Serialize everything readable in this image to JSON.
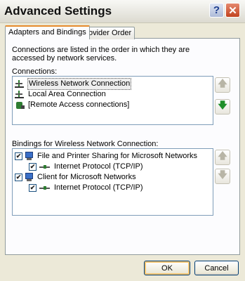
{
  "window": {
    "title": "Advanced Settings",
    "help_label": "?",
    "close_label": "✕"
  },
  "tabs": [
    {
      "label": "Adapters and Bindings",
      "active": true
    },
    {
      "label": "Provider Order",
      "active": false
    }
  ],
  "description": "Connections are listed in the order in which they are accessed by network services.",
  "connections": {
    "label": "Connections:",
    "items": [
      {
        "label": "Wireless Network Connection",
        "icon": "network-adapter-icon",
        "selected": true
      },
      {
        "label": "Local Area Connection",
        "icon": "network-adapter-icon",
        "selected": false
      },
      {
        "label": "[Remote Access connections]",
        "icon": "remote-access-icon",
        "selected": false
      }
    ],
    "move_up": "🡅",
    "move_down": "🡇"
  },
  "bindings": {
    "label": "Bindings for Wireless Network Connection:",
    "items": [
      {
        "label": "File and Printer Sharing for Microsoft Networks",
        "checked": true,
        "level": 0,
        "icon": "service-icon"
      },
      {
        "label": "Internet Protocol (TCP/IP)",
        "checked": true,
        "level": 1,
        "icon": "protocol-icon"
      },
      {
        "label": "Client for Microsoft Networks",
        "checked": true,
        "level": 0,
        "icon": "client-icon"
      },
      {
        "label": "Internet Protocol (TCP/IP)",
        "checked": true,
        "level": 1,
        "icon": "protocol-icon"
      }
    ],
    "move_up": "🡅",
    "move_down": "🡇"
  },
  "buttons": {
    "ok": "OK",
    "cancel": "Cancel"
  }
}
